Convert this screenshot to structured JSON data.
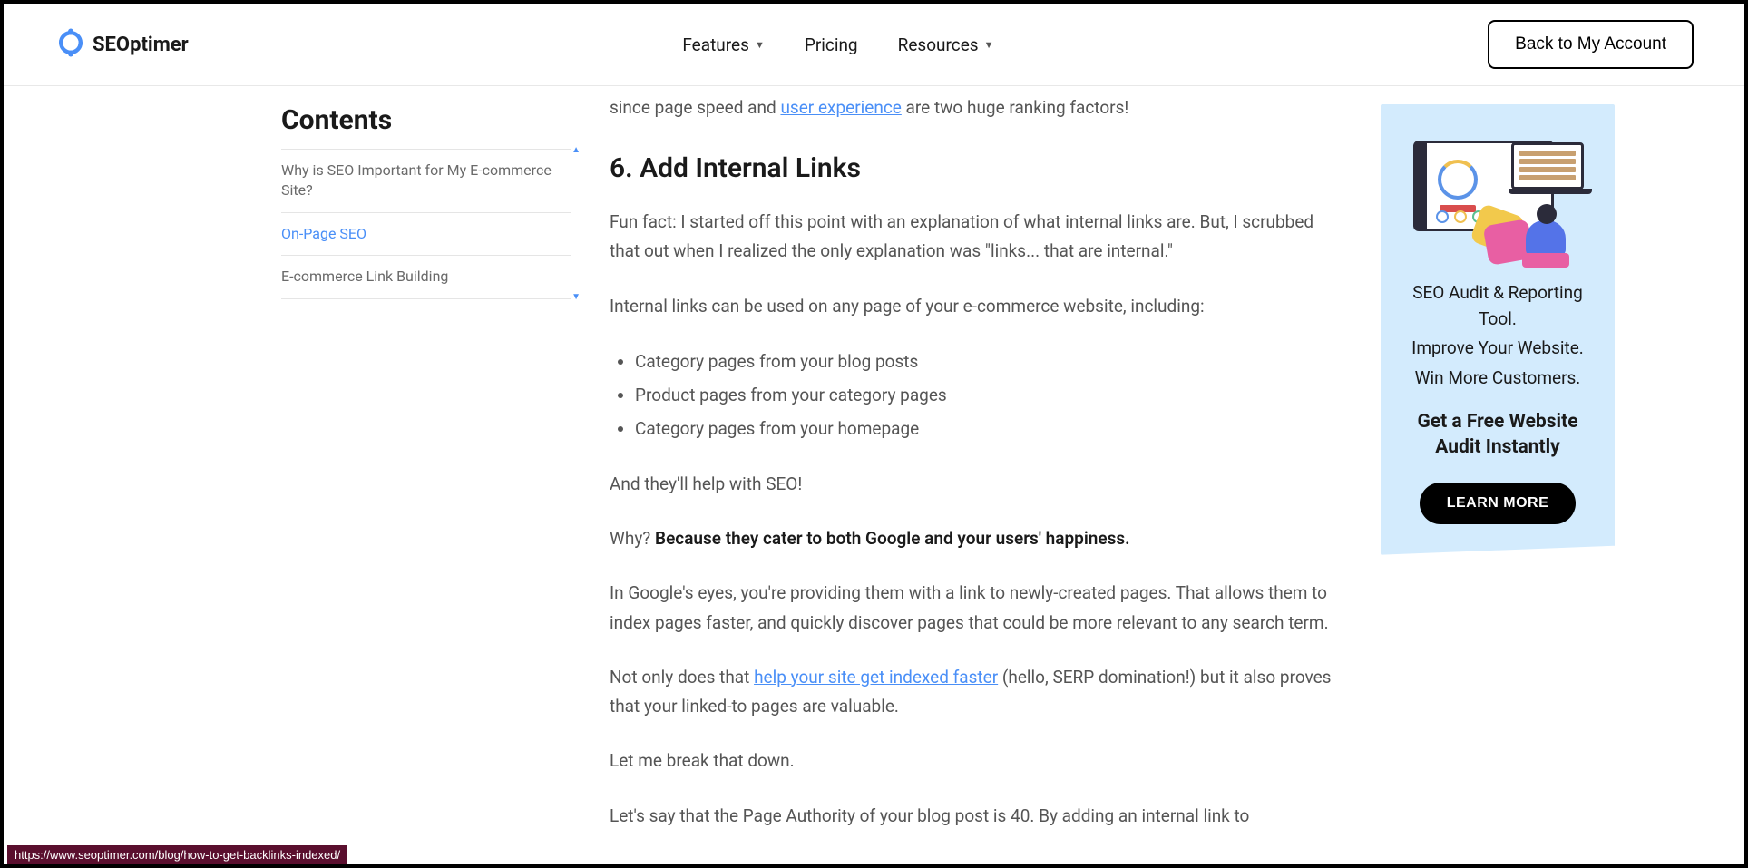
{
  "header": {
    "logo_text": "SEOptimer",
    "nav": {
      "features": "Features",
      "pricing": "Pricing",
      "resources": "Resources"
    },
    "account_btn": "Back to My Account"
  },
  "toc": {
    "title": "Contents",
    "items": [
      {
        "label": "Why is SEO Important for My E-commerce Site?"
      },
      {
        "label": "On-Page SEO"
      },
      {
        "label": "E-commerce Link Building"
      }
    ]
  },
  "article": {
    "frag_before": "since page speed and ",
    "frag_link": "user experience",
    "frag_after": " are two huge ranking factors!",
    "h2": "6. Add Internal Links",
    "p1": "Fun fact: I started off this point with an explanation of what internal links are. But, I scrubbed that out when I realized the only explanation was \"links... that are internal.\"",
    "p2": "Internal links can be used on any page of your e-commerce website, including:",
    "bullets": [
      "Category pages from your blog posts",
      "Product pages from your category pages",
      "Category pages from your homepage"
    ],
    "p3": "And they'll help with SEO!",
    "p4_before": "Why? ",
    "p4_strong": "Because they cater to both Google and your users' happiness.",
    "p5": "In Google's eyes, you're providing them with a link to newly-created pages. That allows them to index pages faster, and quickly discover pages that could be more relevant to any search term.",
    "p6_before": "Not only does that ",
    "p6_link": "help your site get indexed faster",
    "p6_after": " (hello, SERP domination!) but it also proves that your linked-to pages are valuable.",
    "p7": "Let me break that down.",
    "p8": "Let's say that the Page Authority of your blog post is 40. By adding an internal link to"
  },
  "promo": {
    "line1": "SEO Audit & Reporting Tool.",
    "line2": "Improve Your Website.",
    "line3": "Win More Customers.",
    "cta": "Get a Free Website Audit Instantly",
    "button": "LEARN MORE"
  },
  "status_url": "https://www.seoptimer.com/blog/how-to-get-backlinks-indexed/"
}
